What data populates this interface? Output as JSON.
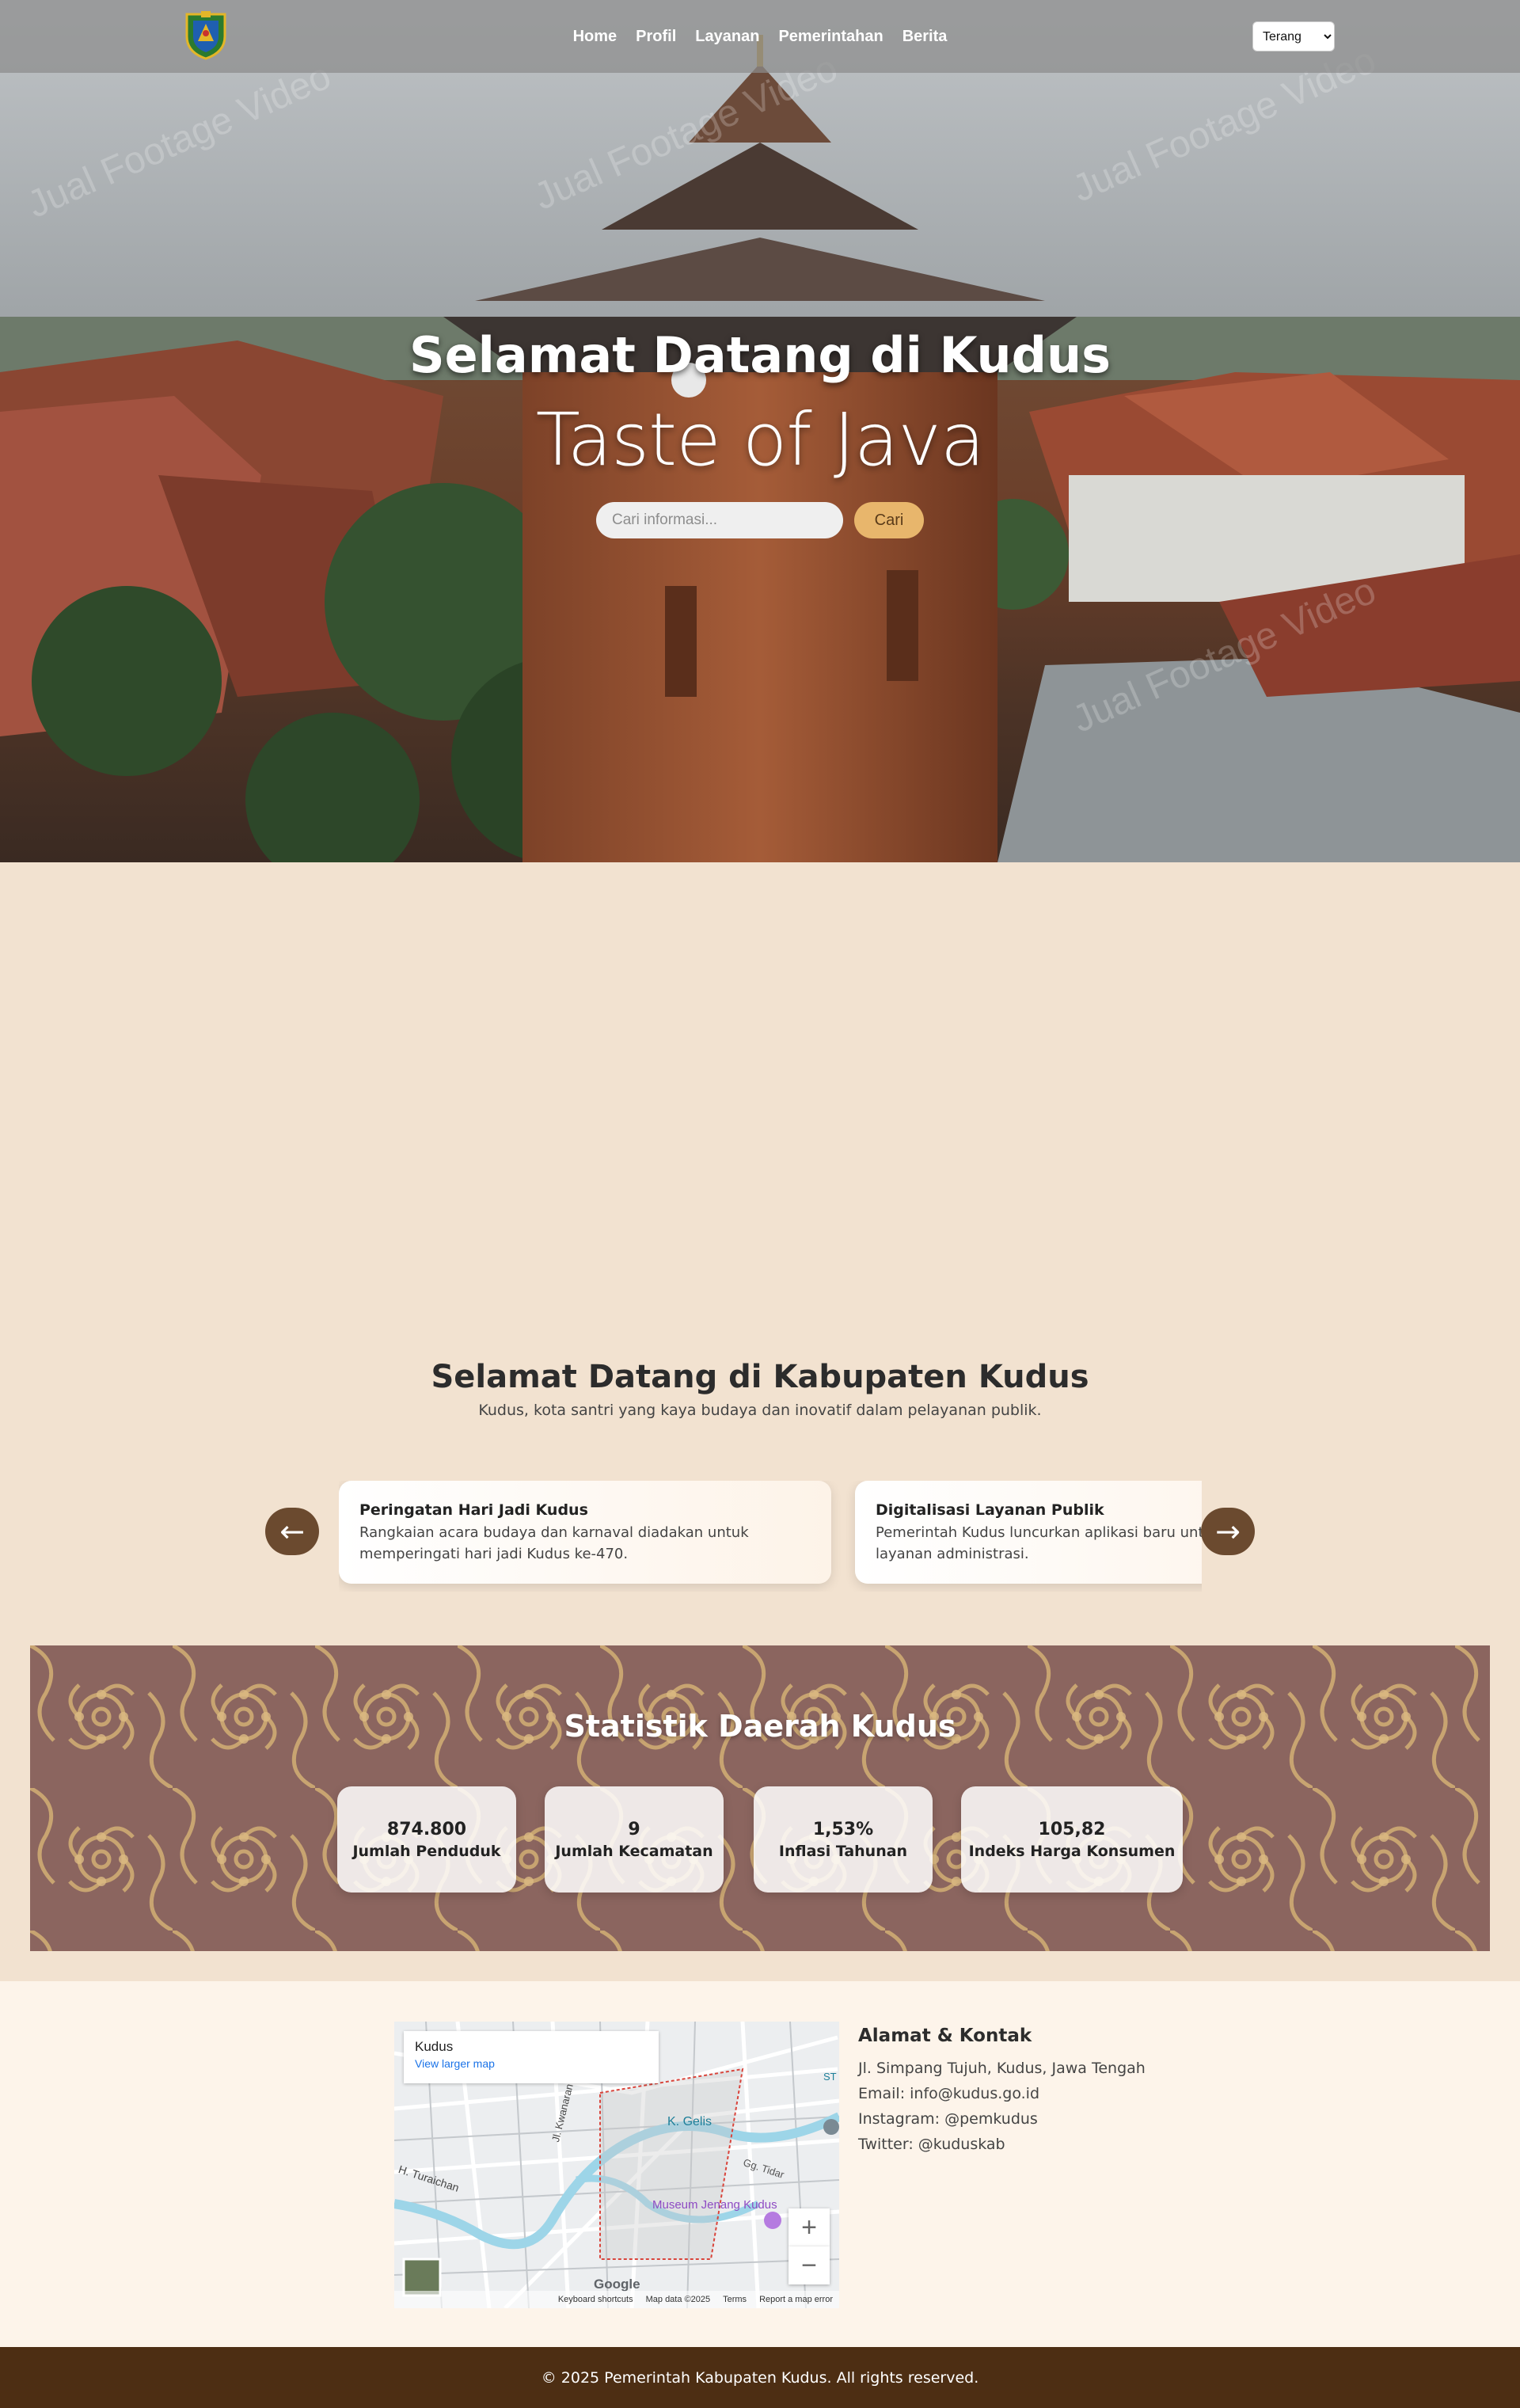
{
  "nav": {
    "logo_alt": "Lambang Kabupaten Kudus",
    "links": [
      "Home",
      "Profil",
      "Layanan",
      "Pemerintahan",
      "Berita"
    ],
    "theme_selected": "Terang"
  },
  "hero": {
    "title": "Selamat Datang di Kudus",
    "subtitle": "Taste of Java",
    "search_placeholder": "Cari informasi...",
    "search_button": "Cari",
    "watermark": "Jual Footage Video"
  },
  "welcome": {
    "title": "Selamat Datang di Kabupaten Kudus",
    "description": "Kudus, kota santri yang kaya budaya dan inovatif dalam pelayanan publik."
  },
  "carousel": {
    "prev": "←",
    "next": "→",
    "items": [
      {
        "title": "Peringatan Hari Jadi Kudus",
        "text": "Rangkaian acara budaya dan karnaval diadakan untuk memperingati hari jadi Kudus ke-470."
      },
      {
        "title": "Digitalisasi Layanan Publik",
        "text": "Pemerintah Kudus luncurkan aplikasi baru untuk akses layanan administrasi."
      }
    ]
  },
  "stats": {
    "title": "Statistik Daerah Kudus",
    "items": [
      {
        "value": "874.800",
        "label": "Jumlah Penduduk"
      },
      {
        "value": "9",
        "label": "Jumlah Kecamatan"
      },
      {
        "value": "1,53%",
        "label": "Inflasi Tahunan"
      },
      {
        "value": "105,82",
        "label": "Indeks Harga Konsumen"
      }
    ]
  },
  "map": {
    "place": "Kudus",
    "link": "View larger map",
    "labels": [
      "K. Gelis",
      "Jl. Kwanaran",
      "H. Turaichan",
      "Gg. Tidar",
      "Museum Jenang Kudus",
      "ST"
    ],
    "footer": [
      "Keyboard shortcuts",
      "Map data ©2025",
      "Terms",
      "Report a map error"
    ],
    "brand": "Google",
    "zoom_in": "+",
    "zoom_out": "−"
  },
  "contact": {
    "title": "Alamat & Kontak",
    "lines": [
      "Jl. Simpang Tujuh, Kudus, Jawa Tengah",
      "Email: info@kudus.go.id",
      "Instagram: @pemkudus",
      "Twitter: @kuduskab"
    ]
  },
  "footer": {
    "copyright": "© 2025 Pemerintah Kabupaten Kudus. All rights reserved."
  },
  "colors": {
    "accent": "#e8b66c",
    "brown": "#6b4a2f",
    "footer": "#4d2e13",
    "background": "#f2e2d0"
  }
}
